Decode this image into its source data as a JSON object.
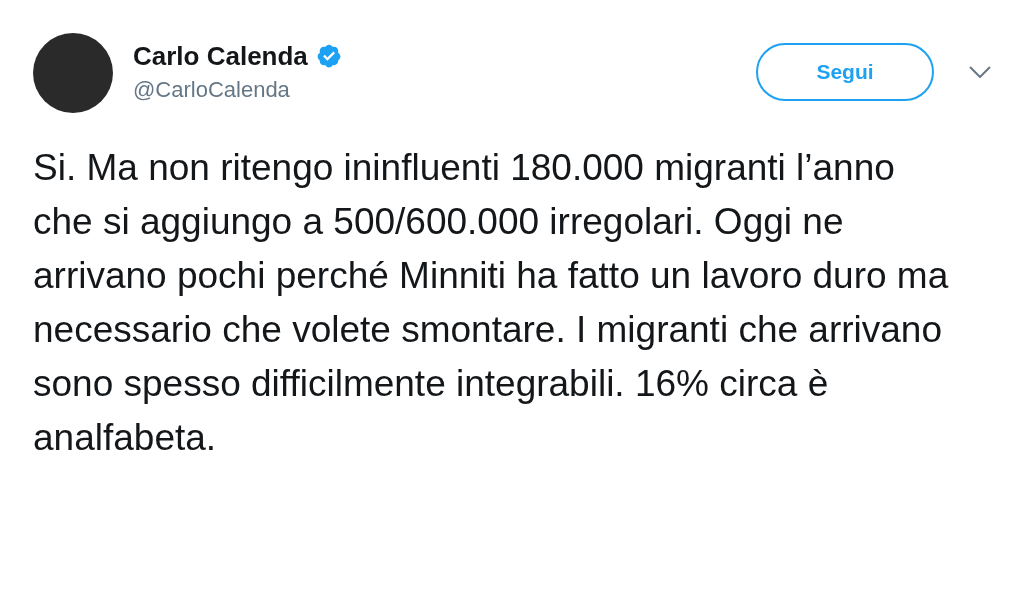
{
  "author": {
    "name": "Carlo Calenda",
    "verified": true,
    "handle": "@CarloCalenda"
  },
  "follow_button": {
    "label": "Segui"
  },
  "tweet": {
    "text": "Si. Ma non ritengo ininfluenti 180.000 migranti l’anno che si aggiungo a 500/600.000 irregolari. Oggi ne arrivano pochi perché Minniti ha fatto un lavoro duro ma necessario che volete smontare. I migranti che arrivano sono spesso difficilmente integrabili. 16% circa è analfabeta."
  }
}
